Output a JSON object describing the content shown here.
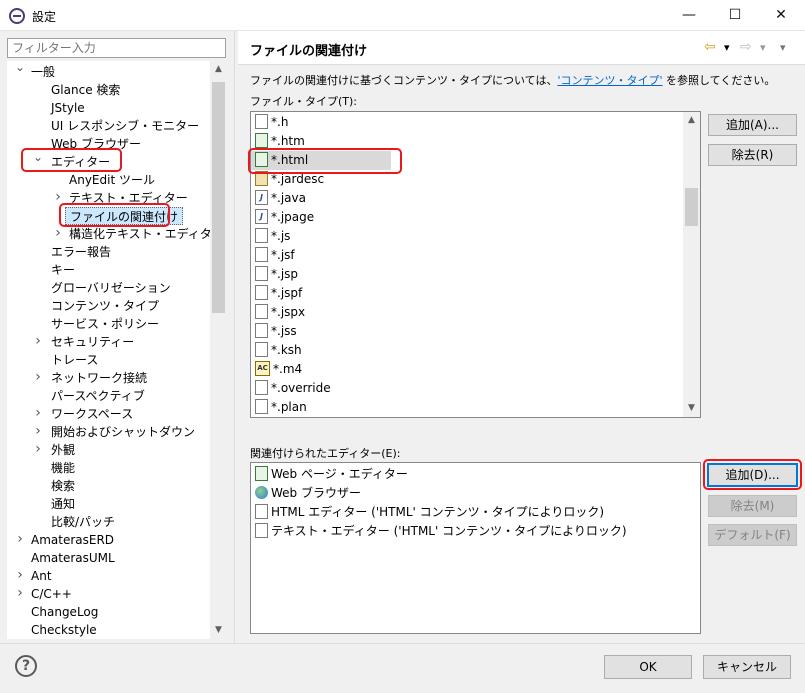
{
  "window": {
    "title": "設定",
    "minimize": "—",
    "maximize": "☐",
    "close": "✕"
  },
  "filter": {
    "placeholder": "フィルター入力"
  },
  "tree": [
    {
      "label": "一般",
      "level": 0,
      "twisty": "open"
    },
    {
      "label": "Glance 検索",
      "level": 1,
      "twisty": "none"
    },
    {
      "label": "JStyle",
      "level": 1,
      "twisty": "none"
    },
    {
      "label": "UI レスポンシブ・モニター",
      "level": 1,
      "twisty": "none"
    },
    {
      "label": "Web ブラウザー",
      "level": 1,
      "twisty": "none"
    },
    {
      "label": "エディター",
      "level": 1,
      "twisty": "open"
    },
    {
      "label": "AnyEdit ツール",
      "level": 2,
      "twisty": "none"
    },
    {
      "label": "テキスト・エディター",
      "level": 2,
      "twisty": "closed"
    },
    {
      "label": "ファイルの関連付け",
      "level": 2,
      "twisty": "none",
      "selected": true
    },
    {
      "label": "構造化テキスト・エディター",
      "level": 2,
      "twisty": "closed"
    },
    {
      "label": "エラー報告",
      "level": 1,
      "twisty": "none"
    },
    {
      "label": "キー",
      "level": 1,
      "twisty": "none"
    },
    {
      "label": "グローバリゼーション",
      "level": 1,
      "twisty": "none"
    },
    {
      "label": "コンテンツ・タイプ",
      "level": 1,
      "twisty": "none"
    },
    {
      "label": "サービス・ポリシー",
      "level": 1,
      "twisty": "none"
    },
    {
      "label": "セキュリティー",
      "level": 1,
      "twisty": "closed"
    },
    {
      "label": "トレース",
      "level": 1,
      "twisty": "none"
    },
    {
      "label": "ネットワーク接続",
      "level": 1,
      "twisty": "closed"
    },
    {
      "label": "パースペクティブ",
      "level": 1,
      "twisty": "none"
    },
    {
      "label": "ワークスペース",
      "level": 1,
      "twisty": "closed"
    },
    {
      "label": "開始およびシャットダウン",
      "level": 1,
      "twisty": "closed"
    },
    {
      "label": "外観",
      "level": 1,
      "twisty": "closed"
    },
    {
      "label": "機能",
      "level": 1,
      "twisty": "none"
    },
    {
      "label": "検索",
      "level": 1,
      "twisty": "none"
    },
    {
      "label": "通知",
      "level": 1,
      "twisty": "none"
    },
    {
      "label": "比較/パッチ",
      "level": 1,
      "twisty": "none"
    },
    {
      "label": "AmaterasERD",
      "level": 0,
      "twisty": "closed"
    },
    {
      "label": "AmaterasUML",
      "level": 0,
      "twisty": "none"
    },
    {
      "label": "Ant",
      "level": 0,
      "twisty": "closed"
    },
    {
      "label": "C/C++",
      "level": 0,
      "twisty": "closed"
    },
    {
      "label": "ChangeLog",
      "level": 0,
      "twisty": "none"
    },
    {
      "label": "Checkstyle",
      "level": 0,
      "twisty": "none"
    }
  ],
  "page": {
    "title": "ファイルの関連付け",
    "description_pre": "ファイルの関連付けに基づくコンテンツ・タイプについては、",
    "description_link": "'コンテンツ・タイプ'",
    "description_post": " を参照してください。",
    "file_types_label": "ファイル・タイプ(T):",
    "editors_label": "関連付けられたエディター(E):"
  },
  "file_types": [
    {
      "name": "*.h",
      "icon": "file"
    },
    {
      "name": "*.htm",
      "icon": "web"
    },
    {
      "name": "*.html",
      "icon": "web",
      "selected": true
    },
    {
      "name": "*.jardesc",
      "icon": "jar"
    },
    {
      "name": "*.java",
      "icon": "java"
    },
    {
      "name": "*.jpage",
      "icon": "java"
    },
    {
      "name": "*.js",
      "icon": "file"
    },
    {
      "name": "*.jsf",
      "icon": "file"
    },
    {
      "name": "*.jsp",
      "icon": "file"
    },
    {
      "name": "*.jspf",
      "icon": "file"
    },
    {
      "name": "*.jspx",
      "icon": "file"
    },
    {
      "name": "*.jss",
      "icon": "file"
    },
    {
      "name": "*.ksh",
      "icon": "file"
    },
    {
      "name": "*.m4",
      "icon": "ac"
    },
    {
      "name": "*.override",
      "icon": "file"
    },
    {
      "name": "*.plan",
      "icon": "file"
    }
  ],
  "editors": [
    {
      "name": "Web ページ・エディター",
      "icon": "web"
    },
    {
      "name": "Web ブラウザー",
      "icon": "globe"
    },
    {
      "name": "HTML エディター ('HTML' コンテンツ・タイプによりロック)",
      "icon": "file"
    },
    {
      "name": "テキスト・エディター ('HTML' コンテンツ・タイプによりロック)",
      "icon": "file"
    }
  ],
  "buttons": {
    "type_add": "追加(A)...",
    "type_remove": "除去(R)",
    "editor_add": "追加(D)...",
    "editor_remove": "除去(M)",
    "editor_default": "デフォルト(F)",
    "ok": "OK",
    "cancel": "キャンセル"
  },
  "icons": {
    "back": "⇦",
    "forward": "⇨",
    "dropdown": "▾",
    "menu": "▾",
    "help": "?",
    "scroll_up": "▲",
    "scroll_down": "▼"
  }
}
